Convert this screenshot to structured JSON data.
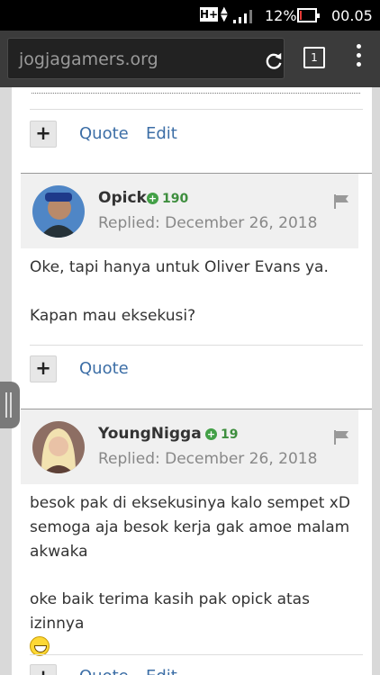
{
  "status_bar": {
    "network": "H+",
    "battery_percent": "12%",
    "battery_level": 0.12,
    "time": "00.05"
  },
  "browser": {
    "url": "jogjagamers.org",
    "tab_count": "1",
    "reload_icon": "reload-icon",
    "menu_icon": "overflow-menu-icon"
  },
  "actions": {
    "plus": "+",
    "quote": "Quote",
    "edit": "Edit"
  },
  "posts": [
    {
      "username": "Opick",
      "reputation": "190",
      "replied": "Replied: December 26, 2018",
      "paragraphs": [
        "Oke, tapi hanya untuk Oliver Evans ya.",
        "Kapan mau eksekusi?"
      ]
    },
    {
      "username": "YoungNigga",
      "reputation": "19",
      "replied": "Replied: December 26, 2018",
      "paragraphs": [
        "besok pak di eksekusinya kalo sempet xD\nsemoga aja besok kerja gak amoe malam akwaka",
        "oke baik terima kasih pak opick atas izinnya"
      ]
    }
  ],
  "colors": {
    "link": "#3c6ea6",
    "reputation": "#43a047",
    "battery_low": "#e53935"
  }
}
